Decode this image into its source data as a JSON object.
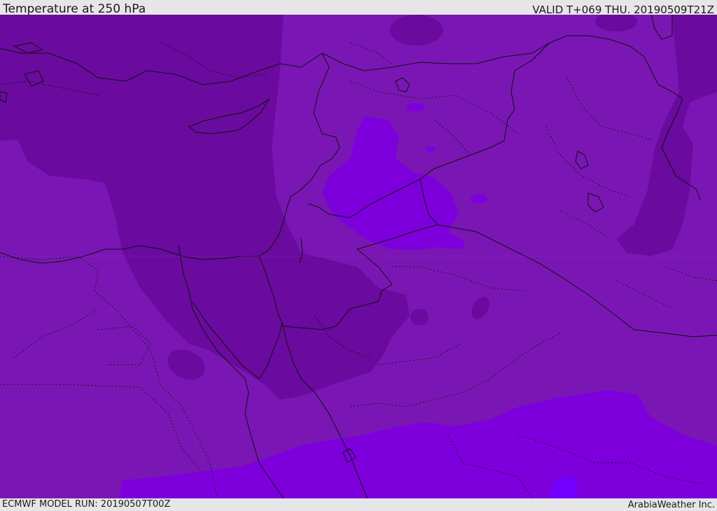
{
  "header": {
    "title": "Temperature at 250 hPa",
    "valid_time": "VALID T+069 THU. 20190509T21Z"
  },
  "footer": {
    "model_run": "ECMWF MODEL RUN: 20190507T00Z",
    "credit": "ArabiaWeather Inc."
  },
  "colors": {
    "cold_dark": "#6a0a9e",
    "base": "#7a17b4",
    "warm": "#7d00dc",
    "warmest": "#7300ff",
    "border_line": "#101010"
  }
}
